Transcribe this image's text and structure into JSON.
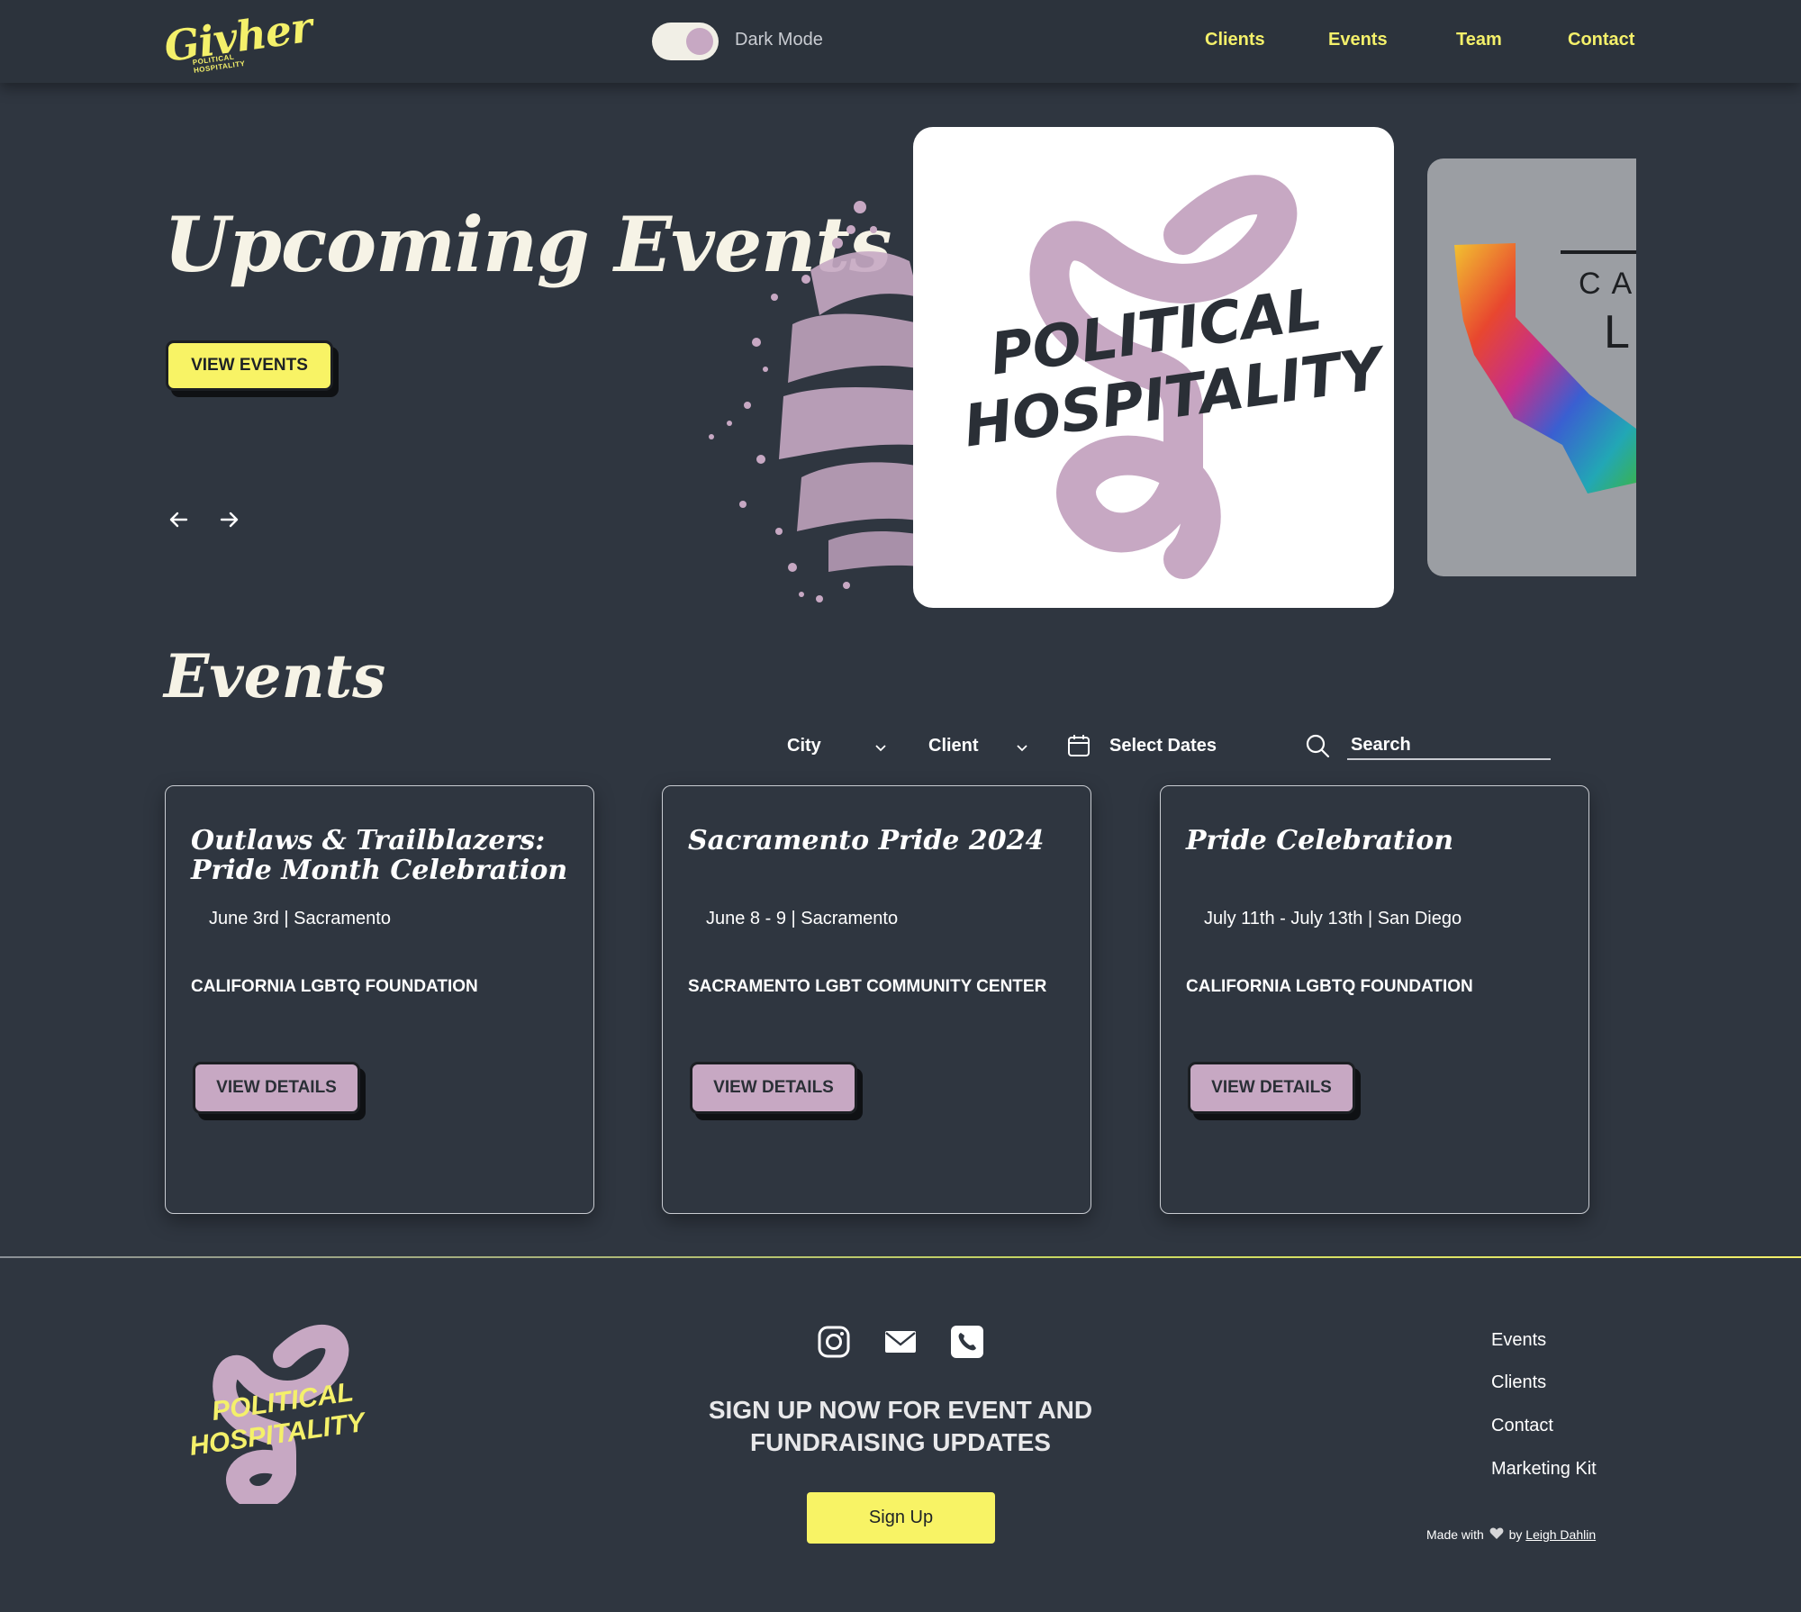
{
  "header": {
    "logo_word": "Givher",
    "logo_sub": "POLITICAL HOSPITALITY",
    "toggle_label": "Dark Mode",
    "nav": [
      "Clients",
      "Events",
      "Team",
      "Contact"
    ]
  },
  "hero": {
    "title": "Upcoming Events",
    "cta": "VIEW EVENTS",
    "slide_logo_line1": "POLITICAL",
    "slide_logo_line2": "HOSPITALITY",
    "next_slide_text1": "CA",
    "next_slide_text2": "L"
  },
  "events": {
    "title": "Events",
    "filters": {
      "city": "City",
      "client": "Client",
      "dates": "Select Dates",
      "search_placeholder": "Search"
    },
    "cards": [
      {
        "title": "Outlaws & Trailblazers: Pride Month Celebration",
        "date": "June 3rd | Sacramento",
        "client": "CALIFORNIA LGBTQ FOUNDATION",
        "button": "VIEW DETAILS"
      },
      {
        "title": "Sacramento Pride 2024",
        "date": "June 8 - 9 | Sacramento",
        "client": "SACRAMENTO LGBT COMMUNITY CENTER",
        "button": "VIEW DETAILS"
      },
      {
        "title": "Pride Celebration",
        "date": "July 11th - July 13th | San Diego",
        "client": "CALIFORNIA LGBTQ FOUNDATION",
        "button": "VIEW DETAILS"
      }
    ]
  },
  "footer": {
    "logo_line1": "POLITICAL",
    "logo_line2": "HOSPITALITY",
    "signup_heading": "SIGN UP NOW FOR EVENT AND FUNDRAISING UPDATES",
    "signup_button": "Sign Up",
    "links": [
      "Events",
      "Clients",
      "Contact",
      "Marketing Kit"
    ],
    "made_with": "Made with",
    "by": "by",
    "author": "Leigh Dahlin"
  },
  "colors": {
    "background": "#2f3640",
    "accent_yellow": "#f8f365",
    "accent_pink": "#c7a8c3"
  },
  "icons": [
    "arrow-left-icon",
    "arrow-right-icon",
    "chevron-down-icon",
    "calendar-icon",
    "search-icon",
    "instagram-icon",
    "mail-icon",
    "phone-icon",
    "heart-icon"
  ]
}
